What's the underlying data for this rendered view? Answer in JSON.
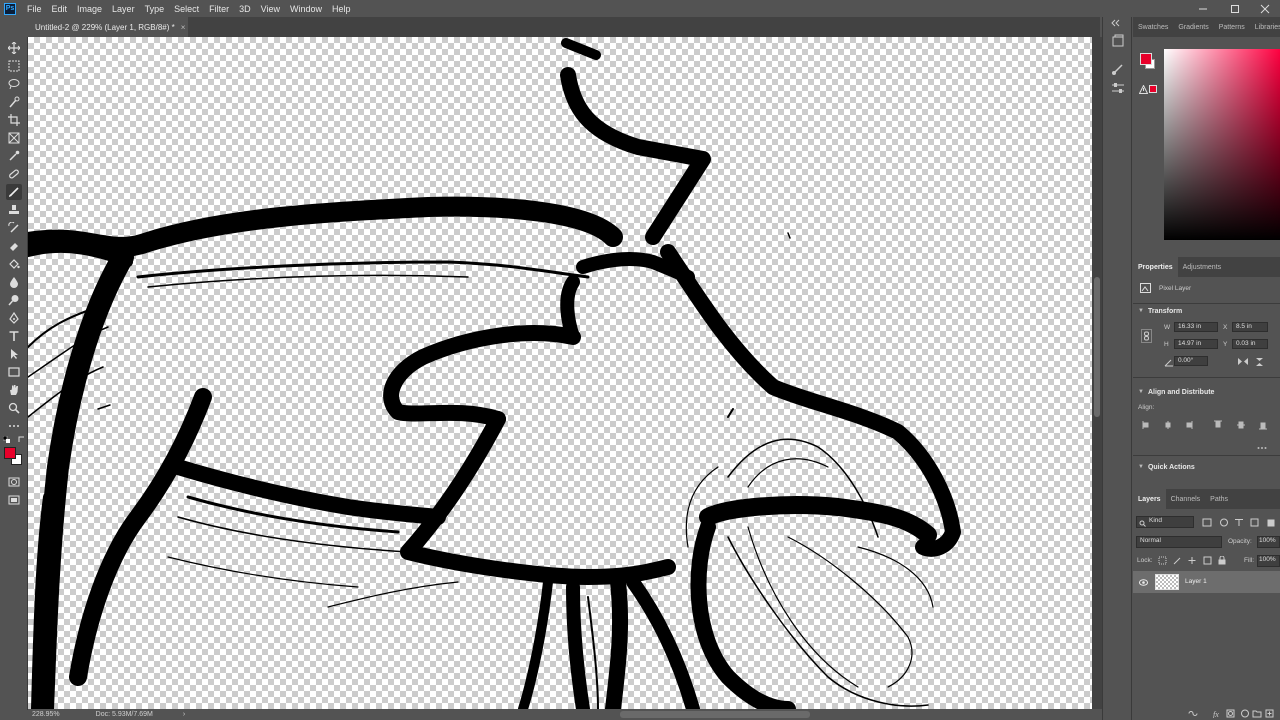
{
  "app": {
    "logo": "Ps",
    "menu": [
      "File",
      "Edit",
      "Image",
      "Layer",
      "Type",
      "Select",
      "Filter",
      "3D",
      "View",
      "Window",
      "Help"
    ]
  },
  "document": {
    "tab_title": "Untitled-2 @ 229% (Layer 1, RGB/8#) *",
    "tab_close": "×"
  },
  "status": {
    "zoom": "228.95%",
    "doc_size": "Doc: 5.93M/7.69M",
    "arrow": "›"
  },
  "colors": {
    "foreground": "#e8002a",
    "background": "#ffffff",
    "accent": "#31a8ff"
  },
  "toolbar": {
    "tools": [
      "move-icon",
      "marquee-icon",
      "lasso-icon",
      "quick-select-icon",
      "crop-icon",
      "frame-icon",
      "eyedropper-icon",
      "healing-icon",
      "brush-icon",
      "stamp-icon",
      "history-brush-icon",
      "eraser-icon",
      "bucket-icon",
      "blur-icon",
      "dodge-icon",
      "pen-icon",
      "type-icon",
      "path-select-icon",
      "rectangle-icon",
      "hand-icon",
      "zoom-icon",
      "more-icon"
    ],
    "active_tool": "brush-icon"
  },
  "color_panel": {
    "tabs": [
      "Swatches",
      "Gradients",
      "Patterns",
      "Libraries"
    ]
  },
  "properties_panel": {
    "tabs": [
      "Properties",
      "Adjustments"
    ],
    "layer_type": "Pixel Layer",
    "transform_title": "Transform",
    "w_label": "W",
    "w_value": "16.33 in",
    "h_label": "H",
    "h_value": "14.97 in",
    "x_label": "X",
    "x_value": "8.5 in",
    "y_label": "Y",
    "y_value": "0.03 in",
    "angle_value": "0.00°",
    "align_title": "Align and Distribute",
    "align_label": "Align:",
    "quick_actions_title": "Quick Actions"
  },
  "layers_panel": {
    "tabs": [
      "Layers",
      "Channels",
      "Paths"
    ],
    "filter_kind": "Kind",
    "blend_mode": "Normal",
    "opacity_label": "Opacity:",
    "opacity_value": "100%",
    "lock_label": "Lock:",
    "fill_label": "Fill:",
    "fill_value": "100%",
    "layers": [
      {
        "name": "Layer 1",
        "visible": true
      }
    ]
  }
}
